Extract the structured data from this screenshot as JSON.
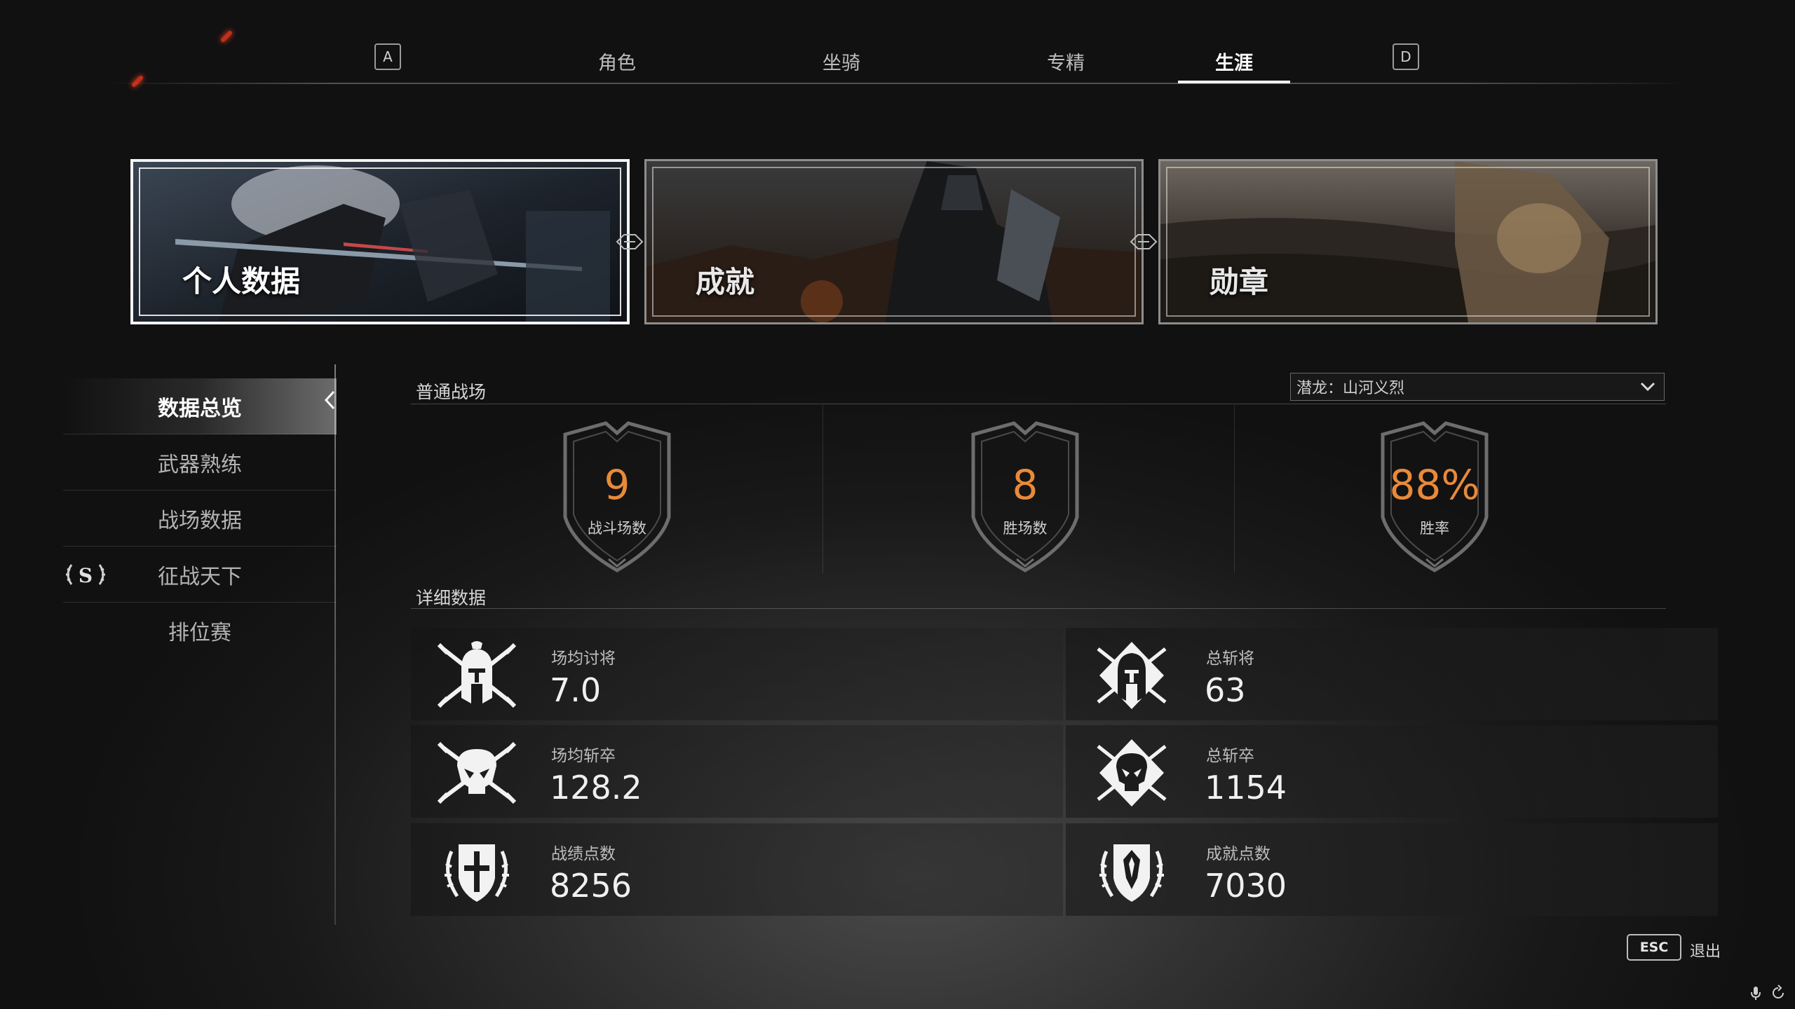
{
  "top_tabs": {
    "prev_key": "A",
    "next_key": "D",
    "items": [
      {
        "label": "角色",
        "active": false
      },
      {
        "label": "坐骑",
        "active": false
      },
      {
        "label": "专精",
        "active": false
      },
      {
        "label": "生涯",
        "active": true
      }
    ]
  },
  "banners": [
    {
      "label": "个人数据",
      "active": true
    },
    {
      "label": "成就",
      "active": false
    },
    {
      "label": "勋章",
      "active": false
    }
  ],
  "sidebar": {
    "items": [
      {
        "label": "数据总览",
        "active": true
      },
      {
        "label": "武器熟练",
        "active": false
      },
      {
        "label": "战场数据",
        "active": false
      },
      {
        "label": "征战天下",
        "active": false,
        "badge": "S"
      },
      {
        "label": "排位赛",
        "active": false
      }
    ]
  },
  "main": {
    "section1_title": "普通战场",
    "season_select": "潜龙：山河义烈",
    "summary": [
      {
        "value": "9",
        "caption": "战斗场数"
      },
      {
        "value": "8",
        "caption": "胜场数"
      },
      {
        "value": "88%",
        "caption": "胜率"
      }
    ],
    "section2_title": "详细数据",
    "details": [
      {
        "label": "场均讨将",
        "value": "7.0",
        "icon": "helmet-crossed-swords-icon"
      },
      {
        "label": "总斩将",
        "value": "63",
        "icon": "helmet-diamond-icon"
      },
      {
        "label": "场均斩卒",
        "value": "128.2",
        "icon": "skull-crossed-swords-icon"
      },
      {
        "label": "总斩卒",
        "value": "1154",
        "icon": "skull-diamond-icon"
      },
      {
        "label": "战绩点数",
        "value": "8256",
        "icon": "cross-shield-laurel-icon"
      },
      {
        "label": "成就点数",
        "value": "7030",
        "icon": "lion-shield-laurel-icon"
      }
    ]
  },
  "footer": {
    "esc_key": "ESC",
    "esc_label": "退出"
  },
  "colors": {
    "accent_orange": "#e88a3a"
  }
}
